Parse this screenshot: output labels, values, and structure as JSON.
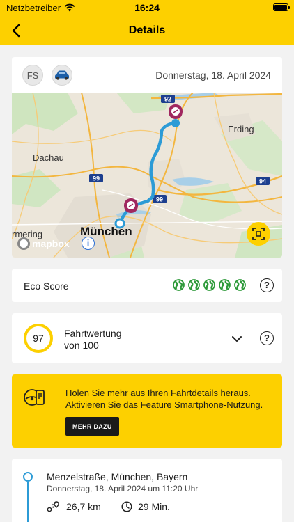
{
  "status_bar": {
    "carrier": "Netzbetreiber",
    "time": "16:24"
  },
  "nav": {
    "title": "Details",
    "back_icon": "chevron-left-icon"
  },
  "trip": {
    "driver_initials": "FS",
    "vehicle_icon": "car-icon",
    "date": "Donnerstag, 18. April 2024",
    "map": {
      "labels": {
        "erding": "Erding",
        "dachau": "Dachau",
        "city": "München",
        "left_edge": "rmering"
      },
      "road_shields": [
        "92",
        "99",
        "99",
        "94"
      ],
      "attribution": "mapbox",
      "info_icon": "info-icon",
      "fullscreen_icon": "fit-route-icon"
    }
  },
  "eco": {
    "label": "Eco Score",
    "icon": "globe-icon",
    "score_max": 5,
    "score": 5,
    "accent": "#2e9a3a"
  },
  "rating": {
    "score": "97",
    "title": "Fahrtwertung",
    "subtitle": "von 100",
    "score_value": 97,
    "ring_color": "#fdd000"
  },
  "promo": {
    "text": "Holen Sie mehr aus Ihren Fahrtdetails heraus. Aktivieren Sie das Feature Smartphone-Nutzung.",
    "button": "MEHR DAZU",
    "icon": "smartphone-car-icon"
  },
  "route": {
    "start_street": "Menzelstraße, München, Bayern",
    "start_time": "Donnerstag, 18. April 2024 um 11:20 Uhr",
    "distance": "26,7 km",
    "duration": "29 Min."
  },
  "colors": {
    "brand_yellow": "#fdd000",
    "route_blue": "#2c9bd6",
    "pin_purple": "#a0275f"
  }
}
